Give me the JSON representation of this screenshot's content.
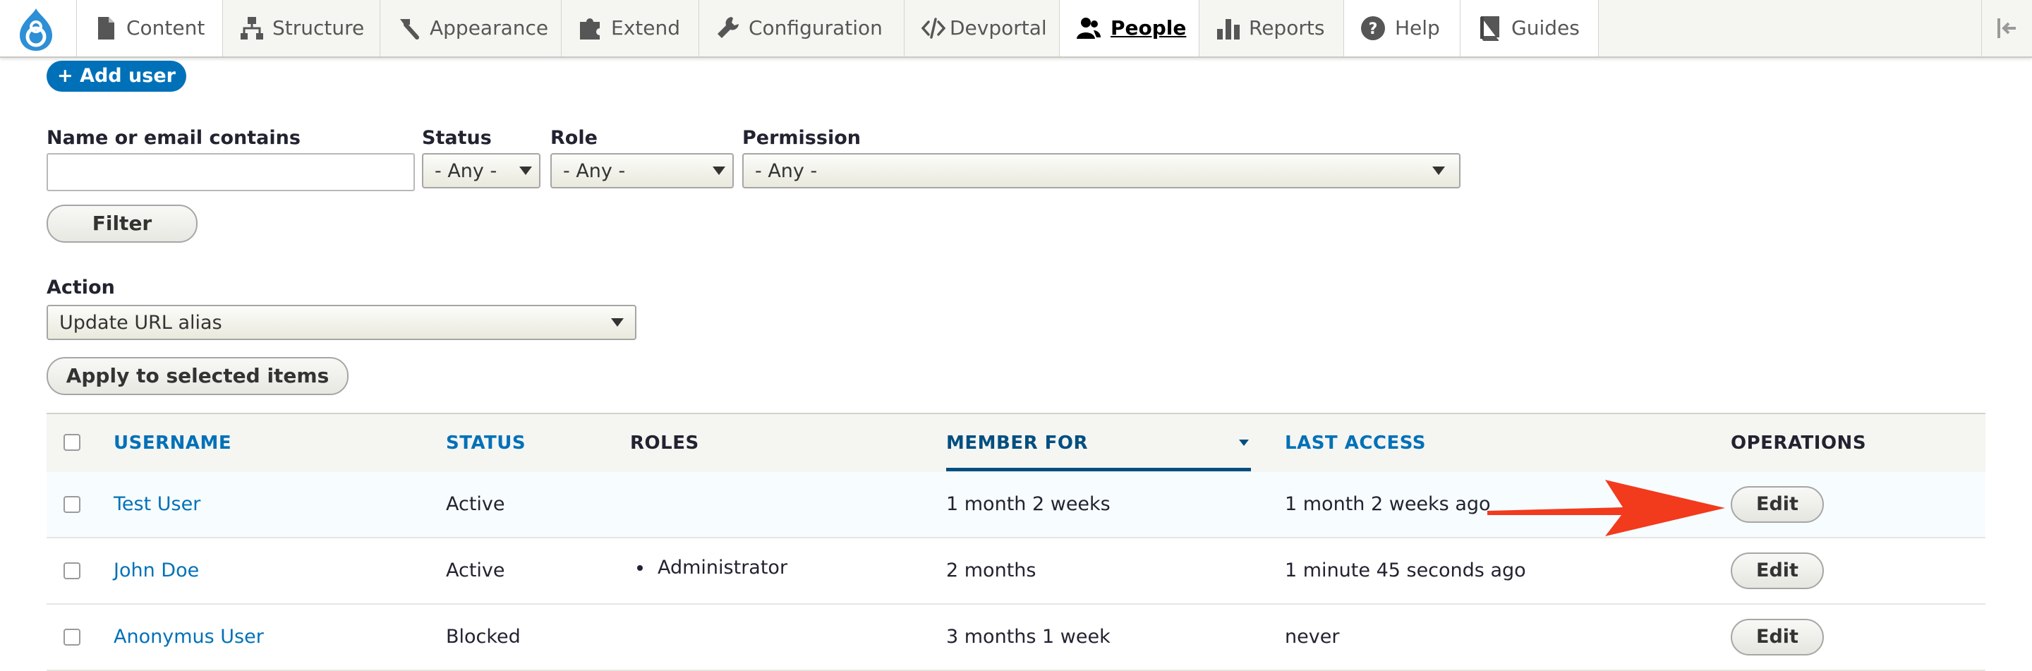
{
  "toolbar": {
    "items": [
      {
        "label": "Content",
        "icon": "file-icon"
      },
      {
        "label": "Structure",
        "icon": "sitemap-icon"
      },
      {
        "label": "Appearance",
        "icon": "paintbrush-icon"
      },
      {
        "label": "Extend",
        "icon": "puzzle-icon"
      },
      {
        "label": "Configuration",
        "icon": "wrench-icon"
      },
      {
        "label": "Devportal",
        "icon": "code-icon"
      },
      {
        "label": "People",
        "icon": "people-icon",
        "active": true
      },
      {
        "label": "Reports",
        "icon": "bar-chart-icon"
      },
      {
        "label": "Help",
        "icon": "help-icon"
      },
      {
        "label": "Guides",
        "icon": "book-icon"
      }
    ]
  },
  "actions": {
    "add_user": "+ Add user"
  },
  "filters": {
    "name_label": "Name or email contains",
    "name_value": "",
    "status_label": "Status",
    "status_value": "- Any -",
    "role_label": "Role",
    "role_value": "- Any -",
    "permission_label": "Permission",
    "permission_value": "- Any -",
    "filter_button": "Filter"
  },
  "bulk": {
    "action_label": "Action",
    "action_value": "Update URL alias",
    "apply_button": "Apply to selected items"
  },
  "table": {
    "headers": {
      "username": "USERNAME",
      "status": "STATUS",
      "roles": "ROLES",
      "member_for": "MEMBER FOR",
      "last_access": "LAST ACCESS",
      "operations": "OPERATIONS"
    },
    "rows": [
      {
        "username": "Test User",
        "status": "Active",
        "roles": "",
        "member_for": "1 month 2 weeks",
        "last_access": "1 month 2 weeks ago",
        "operation": "Edit"
      },
      {
        "username": "John Doe",
        "status": "Active",
        "roles": "Administrator",
        "member_for": "2 months",
        "last_access": "1 minute 45 seconds ago",
        "operation": "Edit"
      },
      {
        "username": "Anonymus User",
        "status": "Blocked",
        "roles": "",
        "member_for": "3 months 1 week",
        "last_access": "never",
        "operation": "Edit"
      }
    ]
  },
  "colors": {
    "link": "#0071b8",
    "primary_button": "#0071b8",
    "annotation_arrow": "#f23a1d"
  }
}
